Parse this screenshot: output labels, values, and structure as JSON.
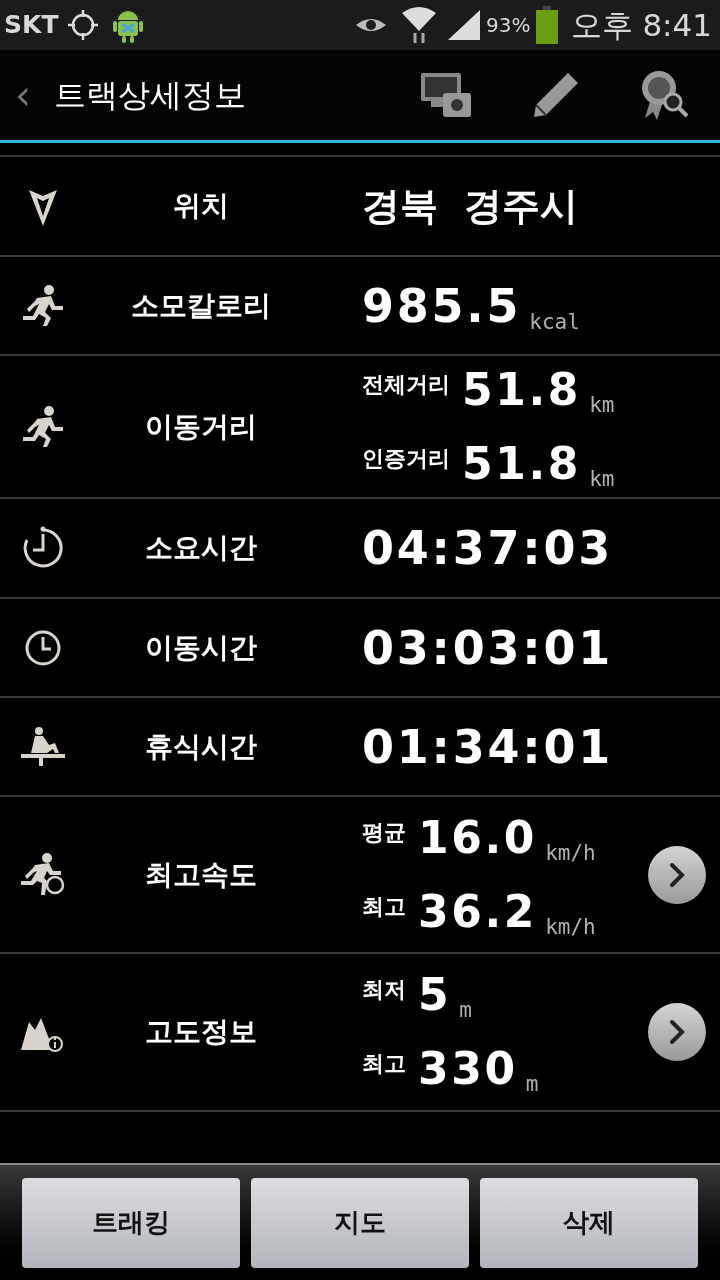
{
  "status_bar": {
    "carrier": "SKT",
    "battery_percent": "93%",
    "time": "오후 8:41"
  },
  "action_bar": {
    "back": "‹",
    "title": "트랙상세정보"
  },
  "rows": [
    {
      "label": "위치",
      "kind": "text",
      "value": "경북  경주시",
      "has_detail": false
    },
    {
      "label": "소모칼로리",
      "kind": "number",
      "value": "985.5",
      "unit": "kcal",
      "has_detail": false
    },
    {
      "label": "이동거리",
      "kind": "pair",
      "lines": [
        {
          "label": "전체거리",
          "value": "51.8",
          "unit": "km"
        },
        {
          "label": "인증거리",
          "value": "51.8",
          "unit": "km"
        }
      ],
      "has_detail": false
    },
    {
      "label": "소요시간",
      "kind": "number",
      "value": "04:37:03",
      "has_detail": false
    },
    {
      "label": "이동시간",
      "kind": "number",
      "value": "03:03:01",
      "has_detail": false
    },
    {
      "label": "휴식시간",
      "kind": "number",
      "value": "01:34:01",
      "has_detail": false
    },
    {
      "label": "최고속도",
      "kind": "pair",
      "lines": [
        {
          "label": "평균",
          "value": "16.0",
          "unit": "km/h"
        },
        {
          "label": "최고",
          "value": "36.2",
          "unit": "km/h"
        }
      ],
      "has_detail": true
    },
    {
      "label": "고도정보",
      "kind": "pair",
      "lines": [
        {
          "label": "최저",
          "value": "5",
          "unit": "m"
        },
        {
          "label": "최고",
          "value": "330",
          "unit": "m"
        }
      ],
      "has_detail": true
    }
  ],
  "buttons": [
    "트래킹",
    "지도",
    "삭제"
  ]
}
